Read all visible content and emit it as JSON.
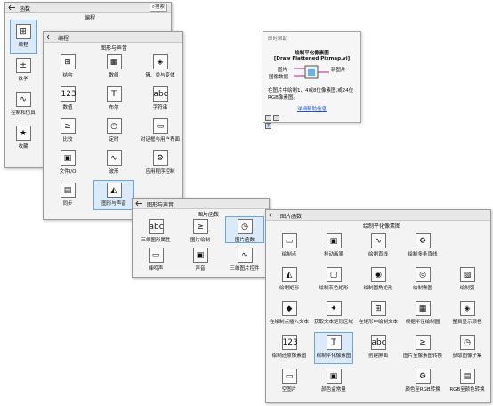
{
  "p1": {
    "title": "函数",
    "search": "搜索",
    "sub": "编程",
    "side": [
      "编程",
      "数学",
      "控制和仿真",
      "收藏"
    ]
  },
  "p2": {
    "title": "编程",
    "sub": "图形与声音",
    "items": [
      "结构",
      "数组",
      "簇、类与变体",
      "数值",
      "布尔",
      "字符串",
      "比较",
      "定时",
      "对话框与用户界面",
      "文件I/O",
      "波形",
      "应用程序控制",
      "同步",
      "图形与声音",
      ""
    ]
  },
  "p3": {
    "title": "图形与声音",
    "sub": "图片函数",
    "items": [
      "三维图形属性",
      "图片绘制",
      "图片函数",
      "蜂鸣声",
      "声音",
      "三维图片控件"
    ]
  },
  "p4": {
    "title": "图片函数",
    "sub": "绘制平化像素图",
    "items": [
      "绘制点",
      "移动画笔",
      "绘制直线",
      "绘制多条直线",
      "",
      "绘制矩形",
      "绘制灰色矩形",
      "绘制圆角矩形",
      "绘制椭圆",
      "绘制弧",
      "在绘制点插入文本",
      "获取文本矩形区域",
      "在矩形中绘制文本",
      "根据半径绘制圆",
      "整目显示颜色",
      "绘制还原像素图",
      "绘制平化像素图",
      "创建屏面",
      "图片至像素图转换",
      "获取图像子集",
      "空图片",
      "颜色盒常量",
      "",
      "颜色至RGB转换",
      "RGB至颜色转换"
    ]
  },
  "help": {
    "header": "即时帮助",
    "name": "绘制平化像素图",
    "vi": "[Draw Flattened Pixmap.vi]",
    "in1": "图片",
    "in2": "图像数据",
    "out": "新图片",
    "desc": "在图片中绘制1、4或8位像素图,或24位RGB像素图。",
    "link": "详细帮助信息"
  },
  "colors": {
    "accent": "#1a4fd8",
    "select": "#dbeaf9"
  }
}
